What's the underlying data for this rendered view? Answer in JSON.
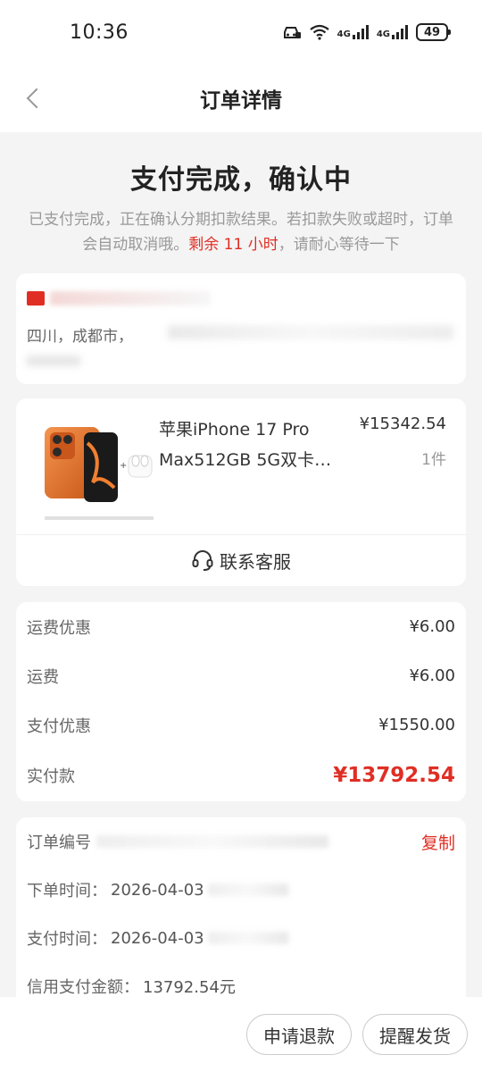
{
  "status_bar": {
    "time": "10:36",
    "network1": "4G",
    "network2": "4G",
    "battery": "49"
  },
  "nav": {
    "title": "订单详情",
    "back_icon": "chevron-left-icon"
  },
  "status": {
    "title": "支付完成，确认中",
    "desc_prefix": "已支付完成，正在确认分期扣款结果。若扣款失败或超时，订单会自动取消哦。",
    "desc_highlight": "剩余 11 小时",
    "desc_suffix": "，请耐心等待一下"
  },
  "address": {
    "line": "四川，成都市，"
  },
  "product": {
    "name_line1": "苹果iPhone 17 Pro",
    "name_line2": "Max512GB 5G双卡…",
    "price": "¥15342.54",
    "qty": "1件",
    "service_label": "联系客服",
    "service_icon": "headset-icon"
  },
  "fees": [
    {
      "label": "运费优惠",
      "value": "¥6.00"
    },
    {
      "label": "运费",
      "value": "¥6.00"
    },
    {
      "label": "支付优惠",
      "value": "¥1550.00"
    }
  ],
  "total": {
    "label": "实付款",
    "value": "¥13792.54"
  },
  "order_info": {
    "order_no_label": "订单编号",
    "copy_label": "复制",
    "order_time_label": "下单时间：",
    "order_time_value": "2026-04-03",
    "pay_time_label": "支付时间：",
    "pay_time_value": "2026-04-03",
    "credit_label": "信用支付金额：",
    "credit_value": "13792.54元"
  },
  "actions": {
    "refund": "申请退款",
    "remind": "提醒发货"
  },
  "colors": {
    "accent_red": "#e02e24",
    "page_bg": "#f4f4f4"
  }
}
